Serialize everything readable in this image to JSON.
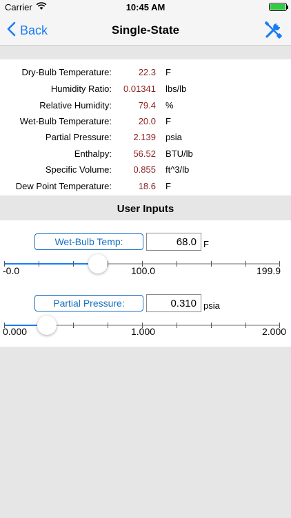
{
  "status_bar": {
    "carrier": "Carrier",
    "time": "10:45 AM"
  },
  "nav": {
    "back_label": "Back",
    "title": "Single-State"
  },
  "results": [
    {
      "label": "Dry-Bulb Temperature:",
      "value": "22.3",
      "unit": "F"
    },
    {
      "label": "Humidity Ratio:",
      "value": "0.01341",
      "unit": "lbs/lb"
    },
    {
      "label": "Relative Humidity:",
      "value": "79.4",
      "unit": "%"
    },
    {
      "label": "Wet-Bulb Temperature:",
      "value": "20.0",
      "unit": "F"
    },
    {
      "label": "Partial Pressure:",
      "value": "2.139",
      "unit": "psia"
    },
    {
      "label": "Enthalpy:",
      "value": "56.52",
      "unit": "BTU/lb"
    },
    {
      "label": "Specific Volume:",
      "value": "0.855",
      "unit": "ft^3/lb"
    },
    {
      "label": "Dew Point Temperature:",
      "value": "18.6",
      "unit": "F"
    }
  ],
  "inputs_header": "User Inputs",
  "inputs": [
    {
      "button_label": "Wet-Bulb Temp:",
      "value": "68.0",
      "unit": "F",
      "slider_min": -0.0,
      "slider_max": 199.9,
      "slider_value": 68.0,
      "scale_min_label": "-0.0",
      "scale_mid_label": "100.0",
      "scale_max_label": "199.9"
    },
    {
      "button_label": "Partial Pressure:",
      "value": "0.310",
      "unit": "psia",
      "slider_min": 0.0,
      "slider_max": 2.0,
      "slider_value": 0.31,
      "scale_min_label": "0.000",
      "scale_mid_label": "1.000",
      "scale_max_label": "2.000"
    }
  ],
  "colors": {
    "accent": "#1a7cf5",
    "value_text": "#8a1f1f",
    "battery": "#2ecc40"
  },
  "icons": {
    "signal": "wifi-icon",
    "back": "chevron-left-icon",
    "tools": "wrench-screwdriver-icon"
  }
}
